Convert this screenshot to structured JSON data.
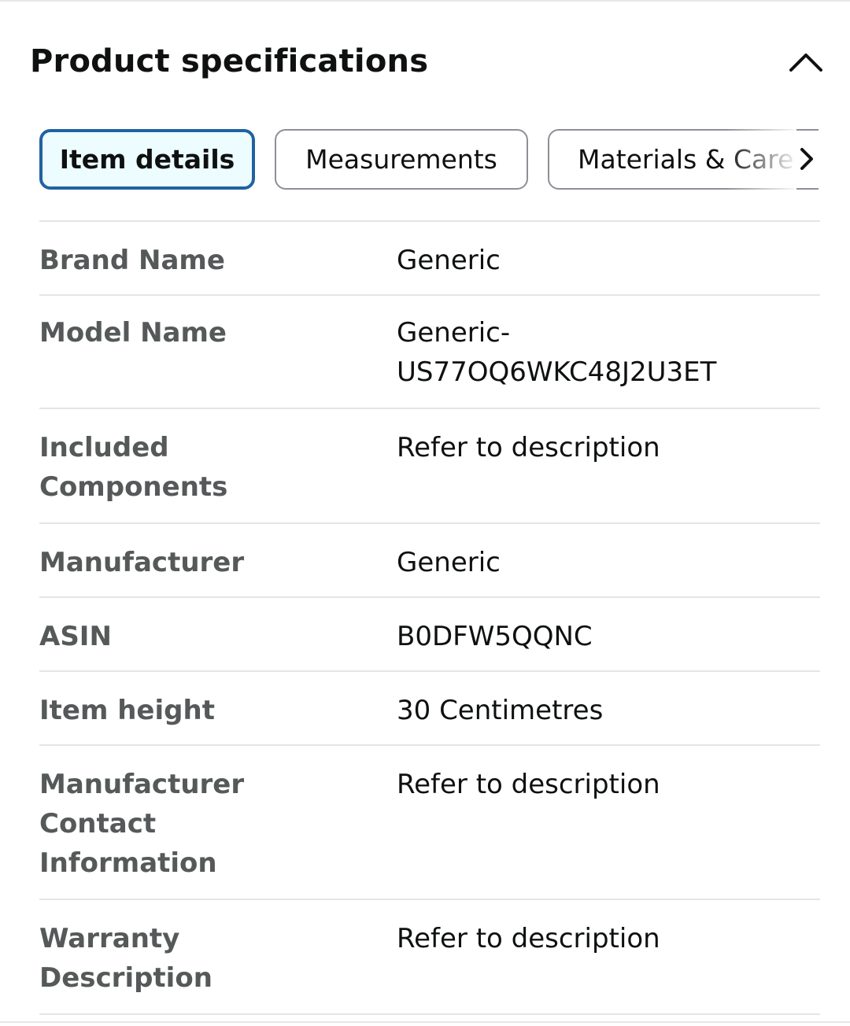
{
  "header": {
    "title": "Product specifications",
    "collapse_icon": "chevron-up-icon"
  },
  "tabs": [
    {
      "label": "Item details",
      "active": true
    },
    {
      "label": "Measurements",
      "active": false
    },
    {
      "label": "Materials & Care",
      "active": false
    }
  ],
  "tabs_scroll_icon": "chevron-right-icon",
  "colors": {
    "active_tab_border": "#2162a1",
    "active_tab_bg": "#edfdff",
    "key_text": "#565959",
    "value_text": "#0f1111",
    "divider": "#e3e6e6"
  },
  "specs": [
    {
      "key": "Brand Name",
      "value": "Generic"
    },
    {
      "key": "Model Name",
      "value": "Generic-\nUS77OQ6WKC48J2U3ET"
    },
    {
      "key": "Included\nComponents",
      "value": "Refer to description"
    },
    {
      "key": "Manufacturer",
      "value": "Generic"
    },
    {
      "key": "ASIN",
      "value": "B0DFW5QQNC"
    },
    {
      "key": "Item height",
      "value": "30 Centimetres"
    },
    {
      "key": "Manufacturer\nContact\nInformation",
      "value": "Refer to description"
    },
    {
      "key": "Warranty\nDescription",
      "value": "Refer to description"
    }
  ]
}
